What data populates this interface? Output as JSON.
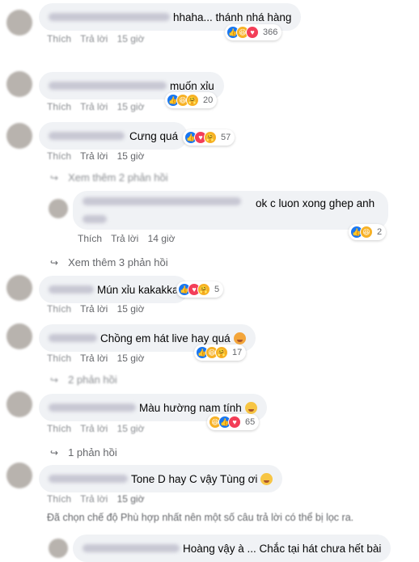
{
  "labels": {
    "like": "Thích",
    "reply": "Trả lời",
    "time_15": "15 giờ",
    "time_14": "14 giờ"
  },
  "comments": [
    {
      "text": "hhaha... thánh nhá hàng",
      "reaction_count": "366"
    },
    {
      "text": "muốn xỉu",
      "reaction_count": "20"
    },
    {
      "text": "Cưng quá",
      "reaction_count": "57"
    },
    {
      "text": "ok c luon xong ghep anh",
      "reaction_count": "2"
    },
    {
      "text": "Mún xỉu kakakka",
      "reaction_count": "5"
    },
    {
      "text": "Chồng em hát live hay quá",
      "reaction_count": "17"
    },
    {
      "text": "Màu hường nam tính",
      "reaction_count": "65"
    },
    {
      "text": "Tone D hay C vậy Tùng ơi",
      "reaction_count": ""
    },
    {
      "text": "Hoàng vậy à ... Chắc tại hát chưa hết bài",
      "reaction_count": ""
    }
  ],
  "view_more": {
    "first": "Xem thêm 2 phản hồi",
    "second": "Xem thêm 3 phản hồi",
    "third": "2 phản hồi",
    "fourth": "1 phản hồi"
  },
  "filter_note": "Đã chọn chế độ Phù hợp nhất nên một số câu trả lời có thể bị lọc ra.",
  "colors": {
    "bubble": "#f0f2f5",
    "meta_text": "#65676b",
    "like_blue": "#1877f2",
    "love_red": "#f33e58",
    "haha_yellow": "#f7b125"
  }
}
